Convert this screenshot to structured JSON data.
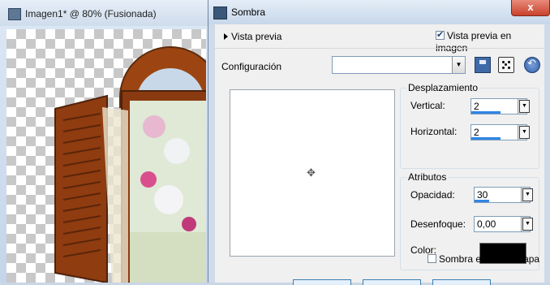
{
  "background_window": {
    "title": "Imagen1* @  80% (Fusionada)",
    "icon": "image-icon"
  },
  "dialog": {
    "title": "Sombra",
    "close_label": "x",
    "preview_toggle_label": "Vista previa",
    "preview_in_image_label": "Vista previa en imagen",
    "preview_in_image_checked": true,
    "config_label": "Configuración",
    "config_value": "",
    "offset": {
      "title": "Desplazamiento",
      "vertical_label": "Vertical:",
      "vertical_value": "2",
      "horizontal_label": "Horizontal:",
      "horizontal_value": "2"
    },
    "attributes": {
      "title": "Atributos",
      "opacity_label": "Opacidad:",
      "opacity_value": "30",
      "blur_label": "Desenfoque:",
      "blur_value": "0,00",
      "color_label": "Color:",
      "color_value": "#000000"
    },
    "new_layer_label": "Sombra en nueva capa",
    "new_layer_checked": false
  },
  "colors": {
    "spin_bar": "#2f86e6",
    "close_button": "#c8412c",
    "shutter_wood": "#8a3a10"
  }
}
